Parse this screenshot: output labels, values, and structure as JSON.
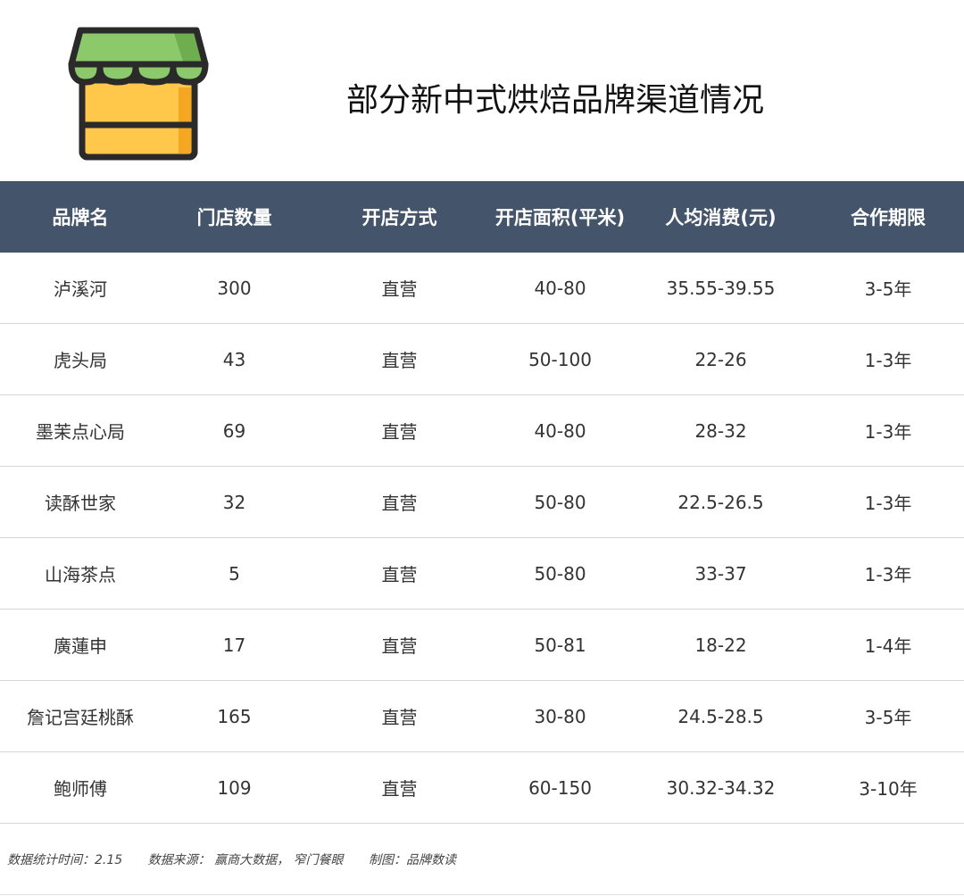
{
  "title": "部分新中式烘焙品牌渠道情况",
  "colors": {
    "header_bg": "#44546a",
    "awning_green": "#8cc96b",
    "shop_yellow": "#ffc84a",
    "shop_orange": "#f5a623",
    "outline": "#2a2a2a"
  },
  "icon": "shop-storefront-icon",
  "table": {
    "headers": [
      "品牌名",
      "门店数量",
      "开店方式",
      "开店面积(平米)",
      "人均消费(元)",
      "合作期限"
    ],
    "rows": [
      [
        "泸溪河",
        "300",
        "直营",
        "40-80",
        "35.55-39.55",
        "3-5年"
      ],
      [
        "虎头局",
        "43",
        "直营",
        "50-100",
        "22-26",
        "1-3年"
      ],
      [
        "墨茉点心局",
        "69",
        "直营",
        "40-80",
        "28-32",
        "1-3年"
      ],
      [
        "读酥世家",
        "32",
        "直营",
        "50-80",
        "22.5-26.5",
        "1-3年"
      ],
      [
        "山海茶点",
        "5",
        "直营",
        "50-80",
        "33-37",
        "1-3年"
      ],
      [
        "廣蓮申",
        "17",
        "直营",
        "50-81",
        "18-22",
        "1-4年"
      ],
      [
        "詹记宫廷桃酥",
        "165",
        "直营",
        "30-80",
        "24.5-28.5",
        "3-5年"
      ],
      [
        "鲍师傅",
        "109",
        "直营",
        "60-150",
        "30.32-34.32",
        "3-10年"
      ]
    ]
  },
  "footer": {
    "stat_time": "数据统计时间：2.15",
    "source": "数据来源： 赢商大数据， 窄门餐眼",
    "credit": "制图：品牌数读"
  }
}
